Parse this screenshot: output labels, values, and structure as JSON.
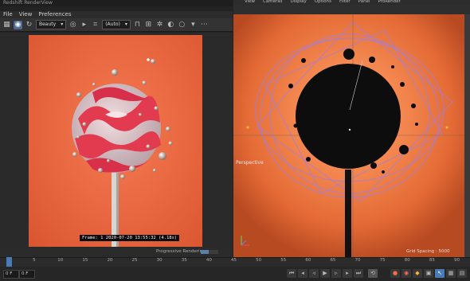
{
  "render_view": {
    "title": "Redshift RenderView",
    "menu": [
      "File",
      "View",
      "Preferences"
    ],
    "aov_select": "Beauty",
    "camera_select": "(Auto)",
    "frame_info": "Frame: 1   2020-07-20  13:55:32  (4.18s)",
    "status_text": "Progressive Rendering...",
    "progress": 0.45
  },
  "viewport": {
    "menu": [
      "View",
      "Cameras",
      "Display",
      "Options",
      "Filter",
      "Panel",
      "ProRender"
    ],
    "label": "Perspective",
    "grid_spacing": "Grid Spacing : 5000"
  },
  "timeline": {
    "ticks": [
      "0",
      "5",
      "10",
      "15",
      "20",
      "25",
      "30",
      "35",
      "40",
      "45",
      "50",
      "55",
      "60",
      "65",
      "70",
      "75",
      "80",
      "85",
      "90"
    ]
  },
  "colors": {
    "accent": "#4a7bb6",
    "render_bg": "#e8663f",
    "viewport_bg": "#f07a44"
  },
  "icons": [
    "film-icon",
    "render-region-icon",
    "refresh-icon",
    "snapshot-icon",
    "crop-icon",
    "lock-icon",
    "grid-icon",
    "settings-icon",
    "circle-icon",
    "play-icon",
    "record-icon",
    "key-icon"
  ]
}
